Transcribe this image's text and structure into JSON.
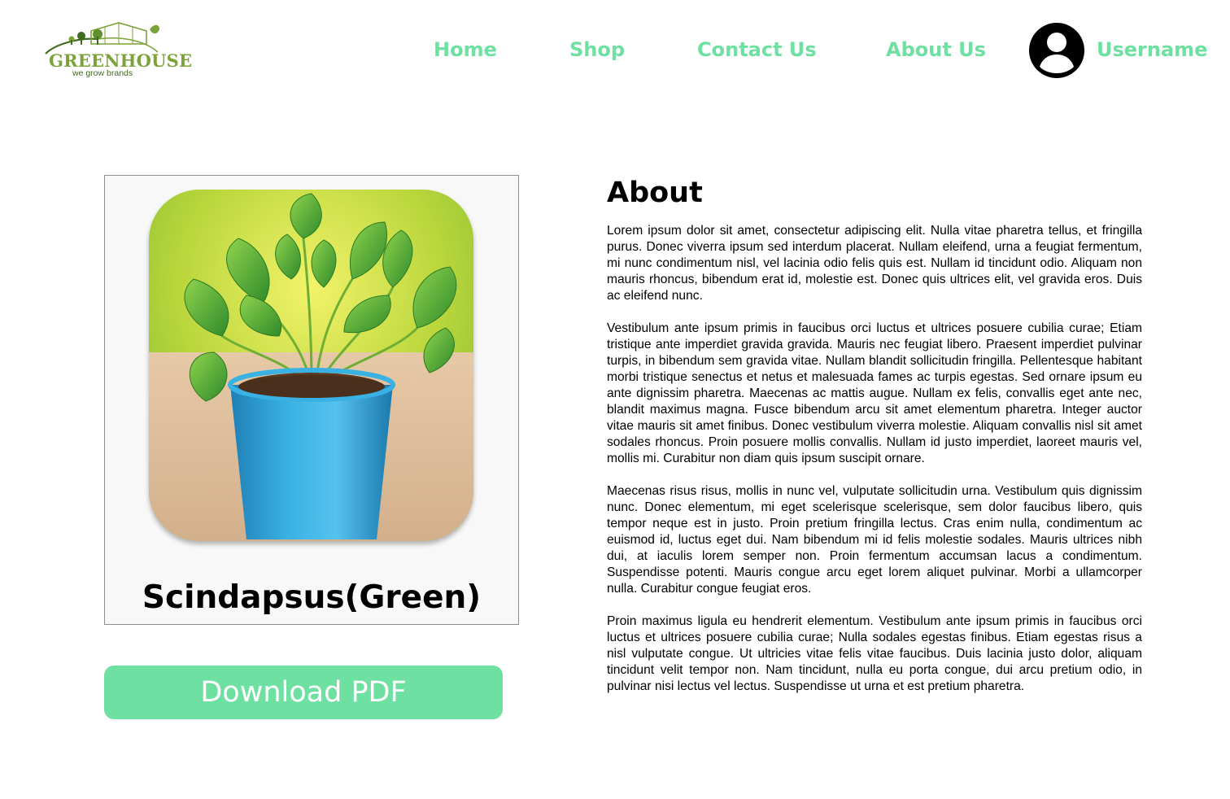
{
  "brand": {
    "name": "GREENHOUSE",
    "tagline": "we grow brands",
    "primary_color": "#7ca33a",
    "dark_color": "#3e6b1f"
  },
  "nav": {
    "items": [
      {
        "label": "Home"
      },
      {
        "label": "Shop"
      },
      {
        "label": "Contact Us"
      },
      {
        "label": "About Us"
      }
    ],
    "accent_color": "#6ee0a2"
  },
  "user": {
    "name": "Username",
    "icon": "account-circle-icon"
  },
  "product": {
    "name": "Scindapsus(Green)",
    "image": "potted-plant-photo"
  },
  "download": {
    "label": "Download PDF"
  },
  "about": {
    "title": "About",
    "paragraphs": [
      "Lorem ipsum dolor sit amet, consectetur adipiscing elit. Nulla vitae pharetra tellus, et fringilla purus. Donec viverra ipsum sed interdum placerat. Nullam eleifend, urna a feugiat fermentum, mi nunc condimentum nisl, vel lacinia odio felis quis est. Nullam id tincidunt odio. Aliquam non mauris rhoncus, bibendum erat id, molestie est. Donec quis ultrices elit, vel gravida eros. Duis ac eleifend nunc.",
      "Vestibulum ante ipsum primis in faucibus orci luctus et ultrices posuere cubilia curae; Etiam tristique ante imperdiet gravida gravida. Mauris nec feugiat libero. Praesent imperdiet pulvinar turpis, in bibendum sem gravida vitae. Nullam blandit sollicitudin fringilla. Pellentesque habitant morbi tristique senectus et netus et malesuada fames ac turpis egestas. Sed ornare ipsum eu ante dignissim pharetra. Maecenas ac mattis augue. Nullam ex felis, convallis eget ante nec, blandit maximus magna. Fusce bibendum arcu sit amet elementum pharetra. Integer auctor vitae mauris sit amet finibus. Donec vestibulum viverra molestie. Aliquam convallis nisl sit amet sodales rhoncus. Proin posuere mollis convallis. Nullam id justo imperdiet, laoreet mauris vel, mollis mi. Curabitur non diam quis ipsum suscipit ornare.",
      "Maecenas risus risus, mollis in nunc vel, vulputate sollicitudin urna. Vestibulum quis dignissim nunc. Donec elementum, mi eget scelerisque scelerisque, sem dolor faucibus libero, quis tempor neque est in justo. Proin pretium fringilla lectus. Cras enim nulla, condimentum ac euismod id, luctus eget dui. Nam bibendum mi id felis molestie sodales. Mauris ultrices nibh dui, at iaculis lorem semper non. Proin fermentum accumsan lacus a condimentum. Suspendisse potenti. Mauris congue arcu eget lorem aliquet pulvinar. Morbi a ullamcorper nulla. Curabitur congue feugiat eros.",
      "Proin maximus ligula eu hendrerit elementum. Vestibulum ante ipsum primis in faucibus orci luctus et ultrices posuere cubilia curae; Nulla sodales egestas finibus. Etiam egestas risus a nisl vulputate congue. Ut ultricies vitae felis vitae faucibus. Duis lacinia justo dolor, aliquam tincidunt velit tempor non. Nam tincidunt, nulla eu porta congue, dui arcu pretium odio, in pulvinar nisi lectus vel lectus. Suspendisse ut urna et est pretium pharetra."
    ]
  }
}
